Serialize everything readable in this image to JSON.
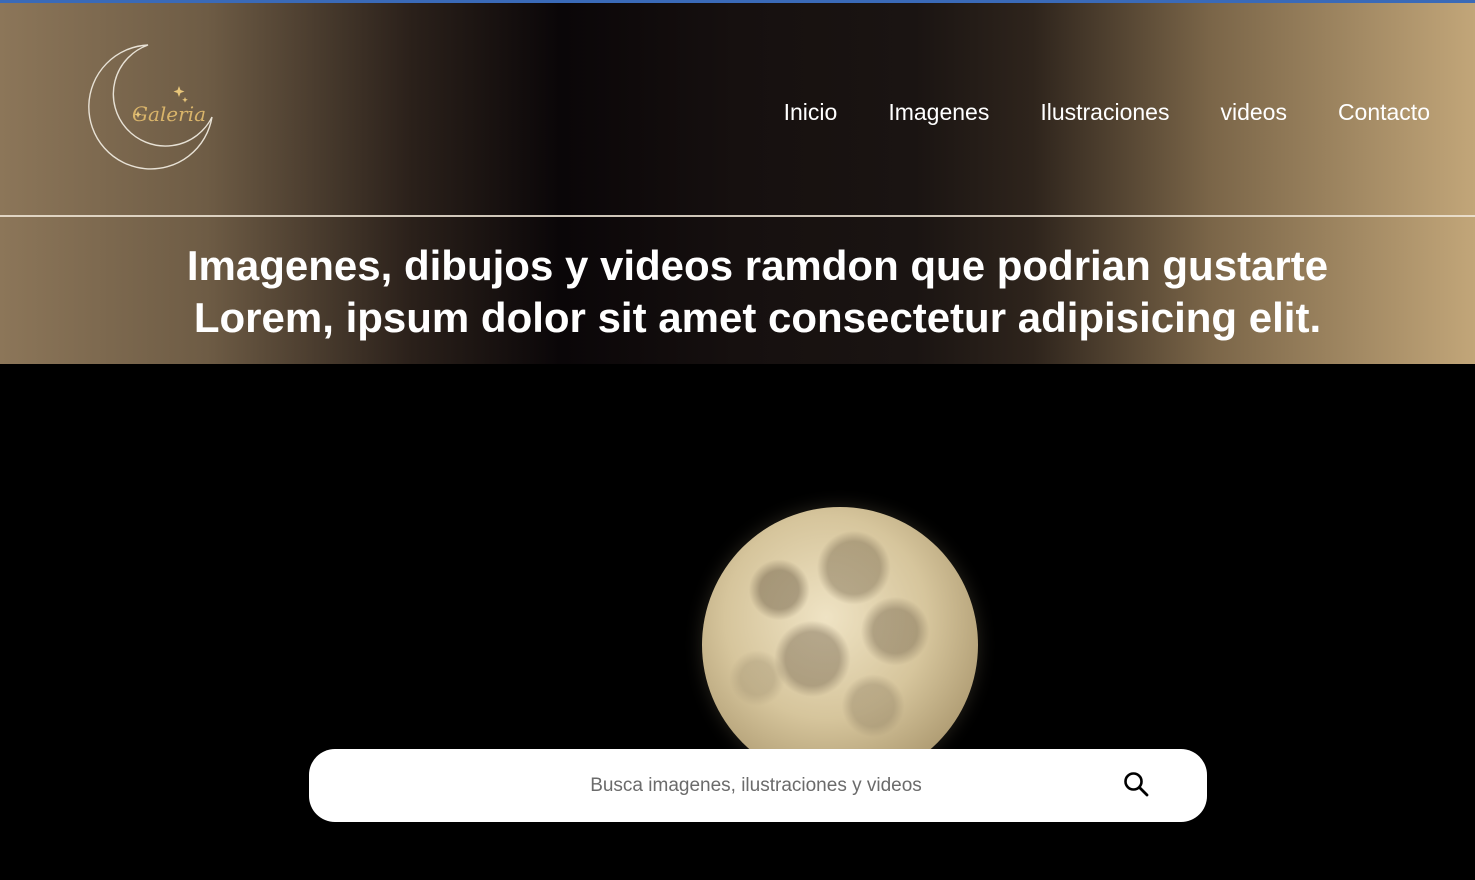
{
  "brand": {
    "logo_text": "Galeria",
    "logo_icon": "crescent-moon-icon"
  },
  "nav": {
    "items": [
      {
        "label": "Inicio"
      },
      {
        "label": "Imagenes"
      },
      {
        "label": "Ilustraciones"
      },
      {
        "label": "videos"
      },
      {
        "label": "Contacto"
      }
    ]
  },
  "headline": {
    "line1": "Imagenes, dibujos y videos ramdon que podrian gustarte",
    "line2": "Lorem, ipsum dolor sit amet consectetur adipisicing elit."
  },
  "search": {
    "placeholder": "Busca imagenes, ilustraciones y videos",
    "value": "",
    "icon": "search-icon"
  },
  "colors": {
    "accent_gold": "#c2a679",
    "background": "#000000",
    "text": "#ffffff"
  }
}
